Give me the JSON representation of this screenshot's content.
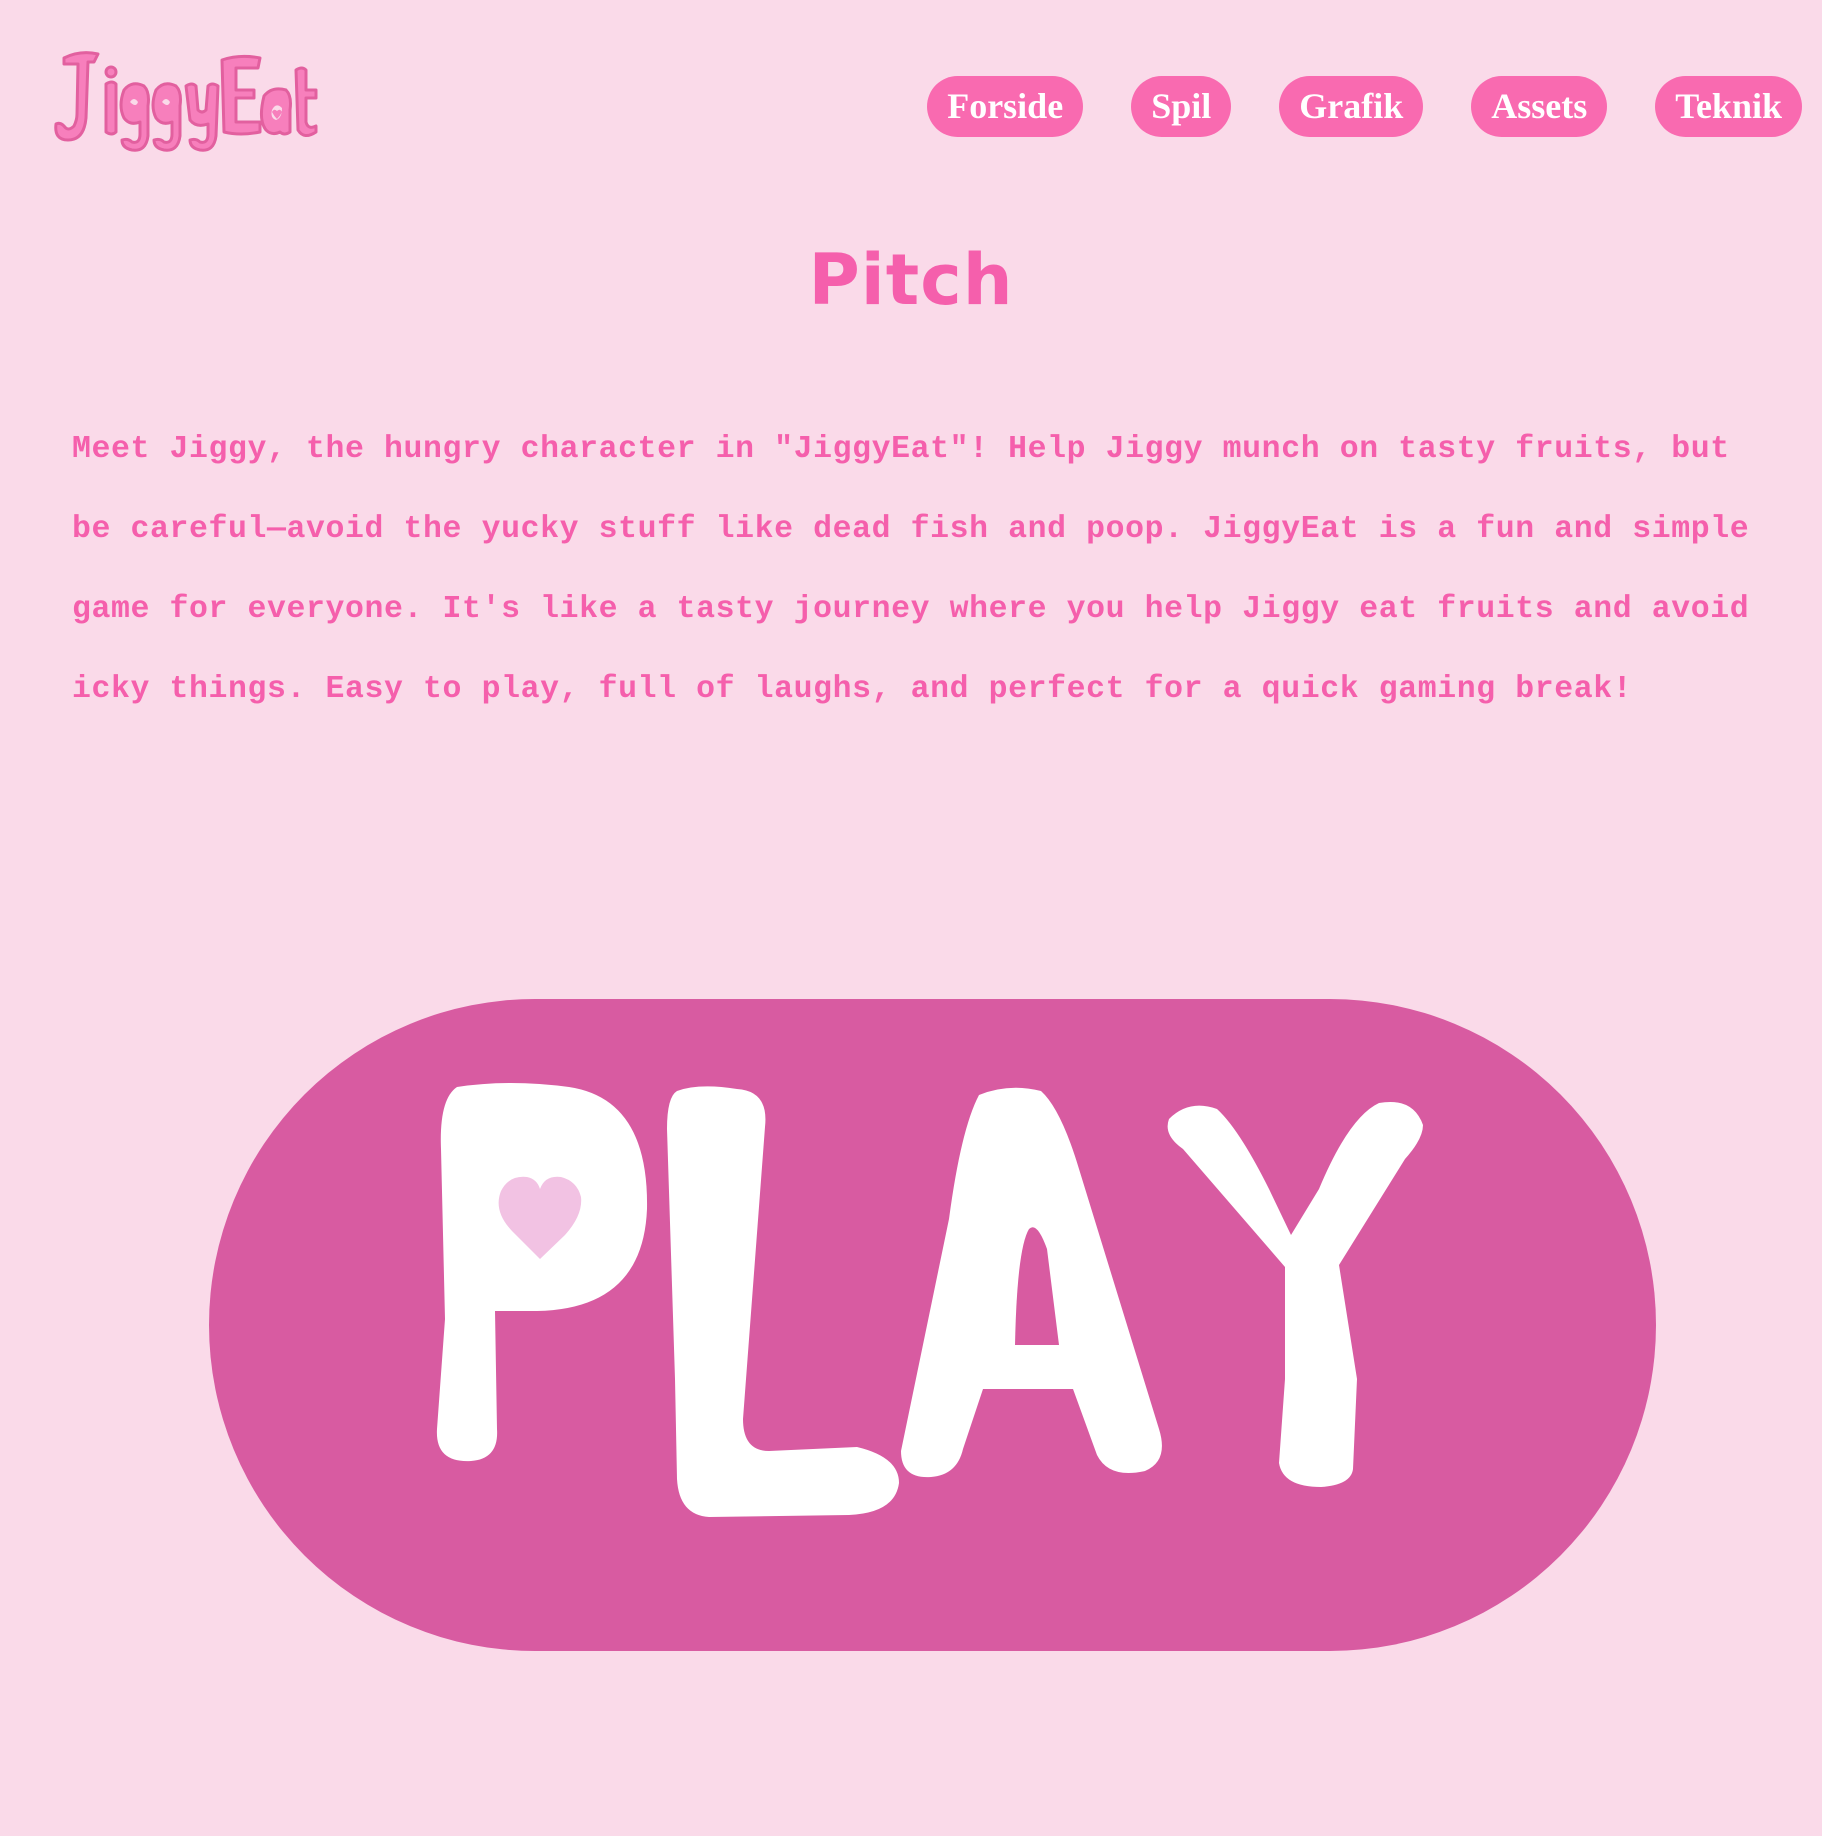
{
  "logo": {
    "text": "JiggyEat"
  },
  "nav": {
    "items": [
      {
        "label": "Forside"
      },
      {
        "label": "Spil"
      },
      {
        "label": "Grafik"
      },
      {
        "label": "Assets"
      },
      {
        "label": "Teknik"
      }
    ]
  },
  "main": {
    "title": "Pitch",
    "pitch": "Meet Jiggy, the hungry character in \"JiggyEat\"! Help Jiggy munch on tasty fruits, but be careful—avoid the yucky stuff like dead fish and poop. JiggyEat is a fun and simple game for everyone. It's like a tasty journey where you help Jiggy eat fruits and avoid icky things. Easy to play, full of laughs, and perfect for a quick gaming break!"
  },
  "play": {
    "label": "PLAY"
  },
  "colors": {
    "background": "#fadae9",
    "accent": "#f96ab0",
    "play_button": "#d85ba1",
    "heart": "#f2c2e3",
    "text_on_accent": "#ffffff"
  },
  "icons": {
    "logo": "jiggyeat-logo",
    "heart": "heart-icon"
  }
}
